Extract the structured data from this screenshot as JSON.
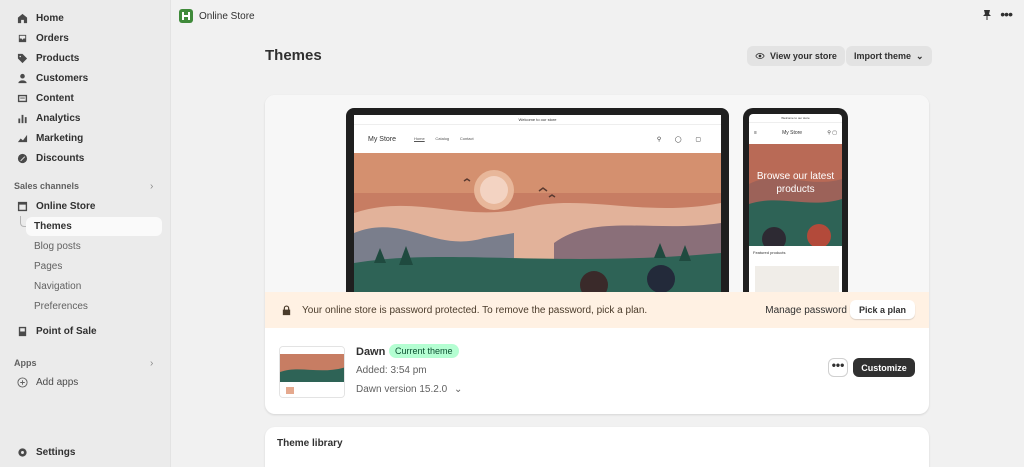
{
  "sidebar": {
    "items": [
      {
        "label": "Home",
        "icon": "home-icon"
      },
      {
        "label": "Orders",
        "icon": "orders-icon"
      },
      {
        "label": "Products",
        "icon": "tag-icon"
      },
      {
        "label": "Customers",
        "icon": "person-icon"
      },
      {
        "label": "Content",
        "icon": "content-icon"
      },
      {
        "label": "Analytics",
        "icon": "analytics-icon"
      },
      {
        "label": "Marketing",
        "icon": "marketing-icon"
      },
      {
        "label": "Discounts",
        "icon": "discount-icon"
      }
    ],
    "sales_channels_label": "Sales channels",
    "online_store": "Online Store",
    "online_store_subitems": [
      "Themes",
      "Blog posts",
      "Pages",
      "Navigation",
      "Preferences"
    ],
    "point_of_sale": "Point of Sale",
    "apps_label": "Apps",
    "add_apps": "Add apps",
    "settings": "Settings"
  },
  "topbar": {
    "title": "Online Store"
  },
  "header": {
    "title": "Themes",
    "view_store": "View your store",
    "import_theme": "Import theme"
  },
  "preview": {
    "announcement": "Welcome to our store",
    "store_name": "My Store",
    "nav_links": [
      "Home",
      "Catalog",
      "Contact"
    ],
    "mobile_hero": "Browse our latest products",
    "mobile_featured": "Featured products"
  },
  "banner": {
    "message": "Your online store is password protected. To remove the password, pick a plan.",
    "manage_password": "Manage password",
    "pick_plan": "Pick a plan"
  },
  "theme": {
    "name": "Dawn",
    "badge": "Current theme",
    "added": "Added: 3:54 pm",
    "version": "Dawn version 15.2.0",
    "customize": "Customize",
    "more": "•••"
  },
  "library": {
    "title": "Theme library"
  },
  "colors": {
    "accent_badge": "#b4fed2",
    "banner_bg": "#fff1e3",
    "primary_button": "#303030"
  }
}
